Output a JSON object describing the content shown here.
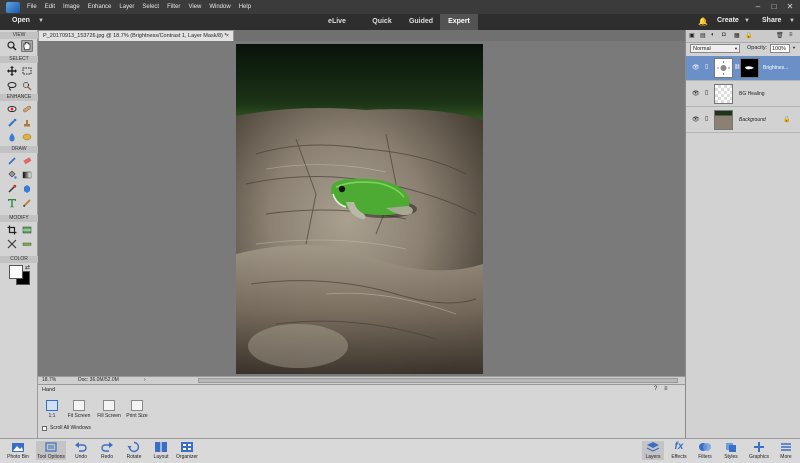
{
  "menubar": {
    "items": [
      "File",
      "Edit",
      "Image",
      "Enhance",
      "Layer",
      "Select",
      "Filter",
      "View",
      "Window",
      "Help"
    ],
    "window_controls": [
      "–",
      "□",
      "✕"
    ]
  },
  "modebar": {
    "open_label": "Open",
    "tabs": [
      "eLive",
      "Quick",
      "Guided",
      "Expert"
    ],
    "active_tab": "Expert",
    "create_label": "Create",
    "share_label": "Share"
  },
  "toolbox": {
    "sections": [
      "VIEW",
      "SELECT",
      "ENHANCE",
      "DRAW",
      "MODIFY",
      "COLOR"
    ],
    "tools": [
      "zoom-icon",
      "hand-icon",
      "move-icon",
      "marquee-icon",
      "lasso-icon",
      "quick-selection-icon",
      "red-eye-icon",
      "spot-healing-icon",
      "smart-brush-icon",
      "clone-stamp-icon",
      "blur-icon",
      "sponge-icon",
      "brush-icon",
      "eraser-icon",
      "paint-bucket-icon",
      "gradient-icon",
      "eyedropper-icon",
      "custom-shape-icon",
      "type-icon",
      "pencil-icon",
      "crop-icon",
      "recompose-icon",
      "content-aware-move-icon",
      "straighten-icon"
    ]
  },
  "document": {
    "tab_title": "P_20170913_153726.jpg @ 18.7% (Brightness/Contrast 1, Layer Mask/8) *",
    "zoom": "18.7%",
    "doc_size": "Doc: 36.0M/52.0M"
  },
  "tool_options": {
    "tool_name": "Hand",
    "buttons": [
      "1:1",
      "Fit Screen",
      "Fill Screen",
      "Print Size"
    ],
    "scroll_all_label": "Scroll All Windows",
    "scroll_all_checked": false
  },
  "layers_panel": {
    "blend_mode": "Normal",
    "opacity_label": "Opacity:",
    "opacity_value": "100%",
    "layers": [
      {
        "name": "Brightness/Contrast 1",
        "display_name": "Brightnes...",
        "selected": true,
        "italic": false
      },
      {
        "name": "BG Healing",
        "display_name": "BG Healing",
        "selected": false,
        "italic": false
      },
      {
        "name": "Background",
        "display_name": "Background",
        "selected": false,
        "italic": true
      }
    ]
  },
  "bottombar": {
    "left": [
      "Photo Bin",
      "Tool Options",
      "Undo",
      "Redo",
      "Rotate",
      "Layout",
      "Organizer"
    ],
    "right": [
      "Layers",
      "Effects",
      "Filters",
      "Styles",
      "Graphics",
      "More"
    ]
  },
  "colors": {
    "menubar_bg": "#3b3b3b",
    "selection_blue": "#6b8fc7",
    "foreground": "#000000",
    "background": "#ffffff"
  }
}
